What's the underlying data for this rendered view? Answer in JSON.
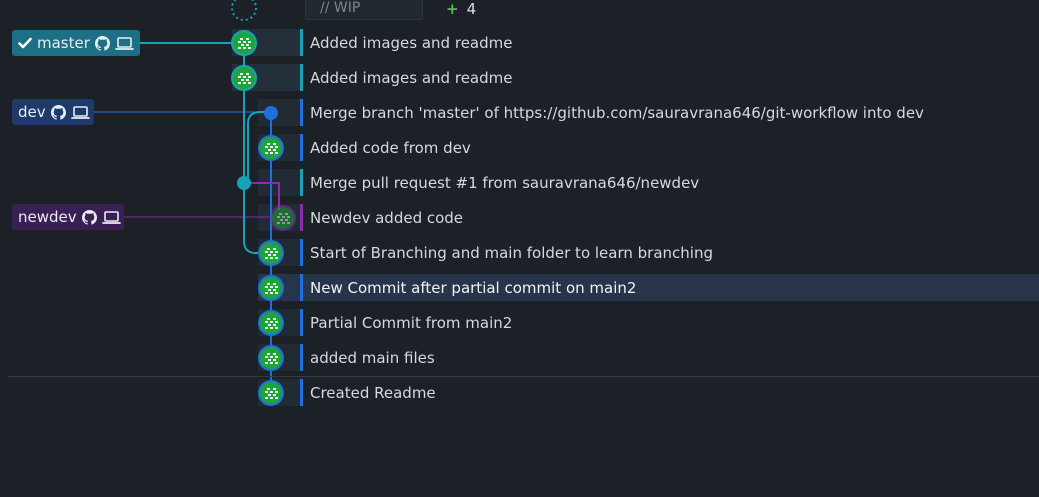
{
  "wip": {
    "placeholder": "// WIP",
    "count_symbol": "+",
    "count": "4"
  },
  "branches": [
    {
      "name": "master",
      "checked": true,
      "color": "#1d6f85"
    },
    {
      "name": "dev",
      "checked": false,
      "color": "#1e3a6a"
    },
    {
      "name": "newdev",
      "checked": false,
      "color": "#3a1f55"
    }
  ],
  "commits": [
    {
      "message": "Added images and readme",
      "lane_color": "#17a2b8"
    },
    {
      "message": "Added images and readme",
      "lane_color": "#17a2b8"
    },
    {
      "message": "Merge branch 'master' of https://github.com/sauravrana646/git-workflow into dev",
      "lane_color": "#1e6fe0"
    },
    {
      "message": "Added code from dev",
      "lane_color": "#1e6fe0"
    },
    {
      "message": "Merge pull request #1 from sauravrana646/newdev",
      "lane_color": "#17a2b8"
    },
    {
      "message": "Newdev added code",
      "lane_color": "#8a2bb0"
    },
    {
      "message": "Start of Branching and main folder to learn branching",
      "lane_color": "#1e6fe0"
    },
    {
      "message": "New Commit after partial commit on main2",
      "lane_color": "#1e6fe0",
      "selected": true
    },
    {
      "message": "Partial Commit from main2",
      "lane_color": "#1e6fe0"
    },
    {
      "message": "added main files",
      "lane_color": "#1e6fe0"
    },
    {
      "message": "Created Readme",
      "lane_color": "#1e6fe0"
    }
  ],
  "colors": {
    "master": "#17a2b8",
    "dev": "#1e6fe0",
    "newdev": "#8a2bb0",
    "avatar_green": "#1fa33a"
  },
  "icons": [
    "check-icon",
    "github-icon",
    "laptop-icon",
    "avatar-icon",
    "plus-icon"
  ]
}
